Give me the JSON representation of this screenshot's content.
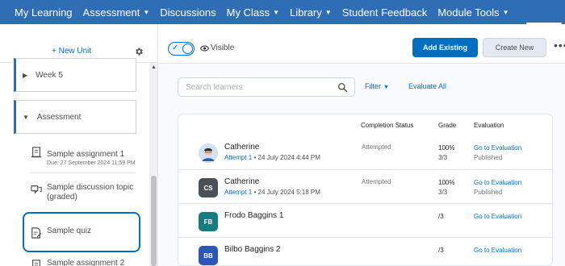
{
  "nav": {
    "items": [
      {
        "label": "My Learning",
        "dropdown": false
      },
      {
        "label": "Assessment",
        "dropdown": true
      },
      {
        "label": "Discussions",
        "dropdown": false
      },
      {
        "label": "My Class",
        "dropdown": true
      },
      {
        "label": "Library",
        "dropdown": true
      },
      {
        "label": "Student Feedback",
        "dropdown": false
      },
      {
        "label": "Module Tools",
        "dropdown": true
      }
    ],
    "background": "#2f6db5"
  },
  "sidebar": {
    "new_unit_label": "+ New Unit",
    "units": [
      {
        "label": "Week 5",
        "expanded": false
      },
      {
        "label": "Assessment",
        "expanded": true
      }
    ],
    "items": [
      {
        "label": "Sample assignment 1",
        "due": "Due: 27 September 2024 11:59 PM",
        "icon": "assignment-icon"
      },
      {
        "label": "Sample discussion topic (graded)",
        "icon": "discussion-icon"
      },
      {
        "label": "Sample quiz",
        "icon": "quiz-icon",
        "selected": true
      },
      {
        "label": "Sample assignment 2",
        "icon": "assignment-icon"
      }
    ]
  },
  "toolbar": {
    "visibility_label": "Visible",
    "add_existing_label": "Add Existing",
    "create_new_label": "Create New",
    "more_label": "•••"
  },
  "search": {
    "placeholder": "Search learners"
  },
  "filter_label": "Filter",
  "evaluate_all_label": "Evaluate All",
  "table": {
    "headers": {
      "status": "Completion Status",
      "grade": "Grade",
      "evaluation": "Evaluation"
    },
    "rows": [
      {
        "name": "Catherine",
        "initials": "",
        "avatar_color": "",
        "photo": true,
        "attempt": "Attempt 1",
        "date": " • 24 July 2024 4:44 PM",
        "status": "Attempted",
        "grade": "100%",
        "grade_sub": "3/3",
        "eval": "Go to Evaluation",
        "published": "Published"
      },
      {
        "name": "Catherine",
        "initials": "CS",
        "avatar_color": "#4a5057",
        "photo": false,
        "attempt": "Attempt 1",
        "date": " • 24 July 2024 5:18 PM",
        "status": "Attempted",
        "grade": "100%",
        "grade_sub": "3/3",
        "eval": "Go to Evaluation",
        "published": "Published"
      },
      {
        "name": "Frodo Baggins 1",
        "initials": "FB",
        "avatar_color": "#167c80",
        "photo": false,
        "attempt": "",
        "date": "",
        "status": "",
        "grade": "/3",
        "grade_sub": "",
        "eval": "Go to Evaluation",
        "published": ""
      },
      {
        "name": "Bilbo Baggins 2",
        "initials": "BB",
        "avatar_color": "#2b57b8",
        "photo": false,
        "attempt": "",
        "date": "",
        "status": "",
        "grade": "/3",
        "grade_sub": "",
        "eval": "Go to Evaluation",
        "published": ""
      }
    ]
  },
  "colors": {
    "accent": "#006fbf",
    "nav": "#2f6db5"
  }
}
